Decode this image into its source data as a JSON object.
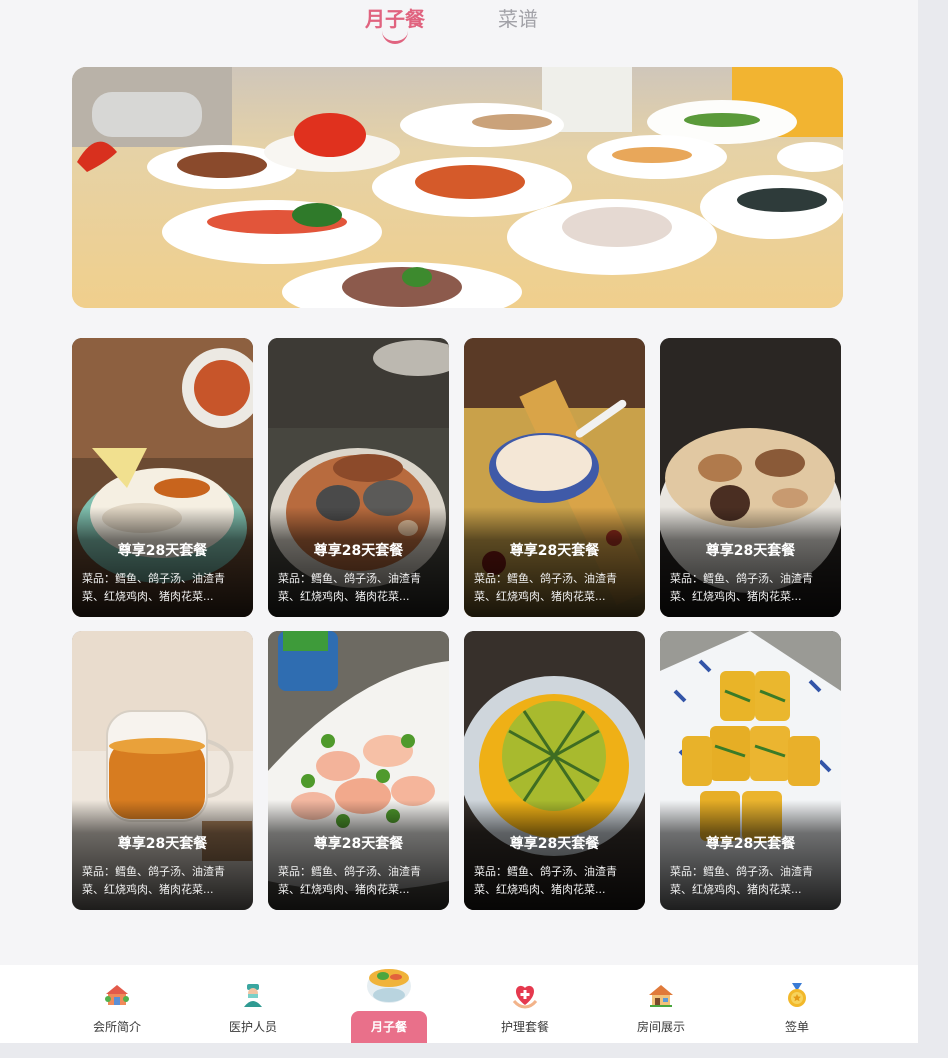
{
  "tabs": [
    {
      "label": "月子餐",
      "active": true
    },
    {
      "label": "菜谱",
      "active": false
    }
  ],
  "accent_color": "#e0637f",
  "banner": {
    "image": "banquet-dishes-photo"
  },
  "cards": [
    {
      "title": "尊享28天套餐",
      "desc": "菜品：鳕鱼、鸽子汤、油渣青菜、红烧鸡肉、猪肉花菜...",
      "image": "cordyceps-chicken-soup-photo"
    },
    {
      "title": "尊享28天套餐",
      "desc": "菜品：鳕鱼、鸽子汤、油渣青菜、红烧鸡肉、猪肉花菜...",
      "image": "mushroom-soup-photo"
    },
    {
      "title": "尊享28天套餐",
      "desc": "菜品：鳕鱼、鸽子汤、油渣青菜、红烧鸡肉、猪肉花菜...",
      "image": "milky-soup-bowl-photo"
    },
    {
      "title": "尊享28天套餐",
      "desc": "菜品：鳕鱼、鸽子汤、油渣青菜、红烧鸡肉、猪肉花菜...",
      "image": "mushroom-noodle-bowl-photo"
    },
    {
      "title": "尊享28天套餐",
      "desc": "菜品：鳕鱼、鸽子汤、油渣青菜、红烧鸡肉、猪肉花菜...",
      "image": "tea-cup-photo"
    },
    {
      "title": "尊享28天套餐",
      "desc": "菜品：鳕鱼、鸽子汤、油渣青菜、红烧鸡肉、猪肉花菜...",
      "image": "shrimp-peas-photo"
    },
    {
      "title": "尊享28天套餐",
      "desc": "菜品：鳕鱼、鸽子汤、油渣青菜、红烧鸡肉、猪肉花菜...",
      "image": "pineapple-dish-photo"
    },
    {
      "title": "尊享28天套餐",
      "desc": "菜品：鳕鱼、鸽子汤、油渣青菜、红烧鸡肉、猪肉花菜...",
      "image": "tofu-skin-rolls-photo"
    }
  ],
  "bottom_nav": [
    {
      "label": "会所简介",
      "icon": "clubhouse-icon",
      "active": false
    },
    {
      "label": "医护人员",
      "icon": "nurse-icon",
      "active": false
    },
    {
      "label": "月子餐",
      "icon": "meal-bowl-icon",
      "active": true
    },
    {
      "label": "护理套餐",
      "icon": "care-heart-icon",
      "active": false
    },
    {
      "label": "房间展示",
      "icon": "house-icon",
      "active": false
    },
    {
      "label": "签单",
      "icon": "medal-icon",
      "active": false
    }
  ],
  "active_nav_color": "#e9708a"
}
